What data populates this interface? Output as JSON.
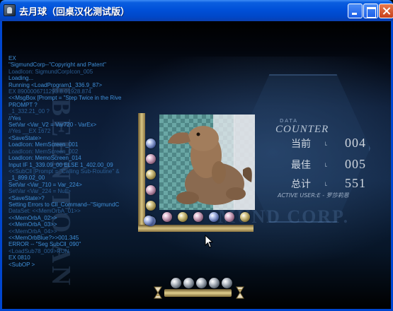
{
  "window": {
    "title": "去月球（回桌汉化测试版）",
    "controls": [
      "minimize",
      "maximize",
      "close"
    ]
  },
  "log_lines": [
    "EX",
    "\"SigmundCorp--\"Copyright and Patent\"",
    "LoadIcon: SigmundCorpIcon_005",
    "Loading...",
    "Running <LoadProgram1_336.9_87>",
    "EX 8900006711293.8.01928.874",
    "<<MsgBox [Prompt = \"Step Twice in the Rive",
    "PROMPT ?",
    "_1_332.21_00 ?",
    "//Yes",
    "SetVar <Var_V2 = Var720 - VarEx>",
    "//Yes __EX 1672",
    "<SaveState>",
    "LoadIcon: MemScreen_001",
    "LoadIcon: MemScreen_002",
    "LoadIcon: MemoScreen_014",
    "Input IF 1_339.09_00 ELSE 1_402.00_09",
    "<<SubCll [Prompt = \"Calling Sub-Routine\" &",
    "_1_899.02_00",
    "SetVar <Var_710 = Var_224>",
    "SetVar <Var_224 = Null>",
    "<SaveState>?",
    "Setting Errors to Cll_Command--\"SigmundC",
    "DataSet: <<MemOrbA_01>>",
    "<<MemOrbA_02>>",
    "<<MemOrbA_03>>",
    "<<MemOrbA_04>>",
    "<<MemOrbBlue?>>001.345",
    "ERROR -- \"Seg SubCll_090\"",
    "<LoadSub78_009>RUN",
    "EX 0810",
    "<SubOP >"
  ],
  "counter": {
    "title_small": "DATA",
    "title": "COUNTER",
    "rows": [
      {
        "label": "当前",
        "value": "004"
      },
      {
        "label": "最佳",
        "value": "005"
      },
      {
        "label": "总计",
        "value": "551"
      }
    ],
    "active_user": "ACTIVE USER:E - 罗莎莉恩"
  },
  "background_text": {
    "corp": "MUND CORP."
  },
  "left_marbles": [
    "blue",
    "pink",
    "gold",
    "pink",
    "gold",
    "blue"
  ],
  "bottom_marbles": [
    "pink",
    "gold",
    "pink",
    "blue",
    "pink",
    "gold"
  ],
  "timer_marbles": 5
}
